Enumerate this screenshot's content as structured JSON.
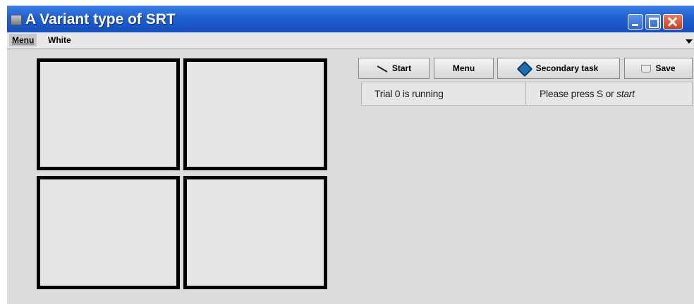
{
  "window": {
    "title": "A Variant type of SRT"
  },
  "menubar": {
    "menu_label": "Menu",
    "color_value": "White"
  },
  "toolbar": {
    "start_label": "Start",
    "menu_label": "Menu",
    "secondary_label": "Secondary task",
    "save_label": "Save"
  },
  "status": {
    "trial": "Trial 0 is running",
    "hint_prefix": "Please press S or ",
    "hint_emph": "start"
  },
  "stimulus": {
    "box_color": "#e5e5e5",
    "border_color": "#000000"
  },
  "icons": [
    "app-icon",
    "minimize-icon",
    "maximize-icon",
    "close-icon",
    "start-icon",
    "secondary-task-icon",
    "save-icon",
    "dropdown-arrow-icon"
  ]
}
